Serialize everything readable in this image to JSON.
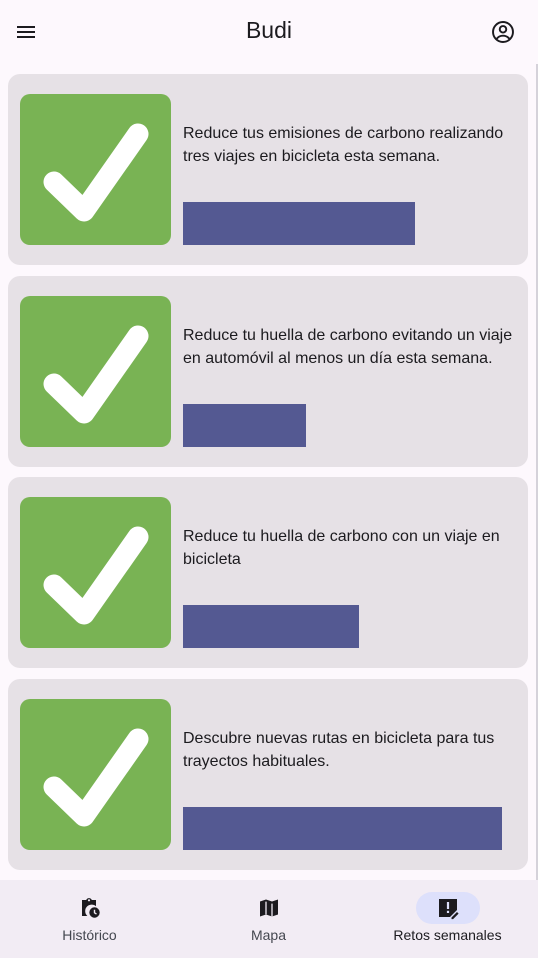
{
  "app": {
    "title": "Budi"
  },
  "challenges": [
    {
      "text": "Reduce tus emisiones de carbono realizando tres viajes en bicicleta esta semana.",
      "progress": 0.7,
      "completed": true
    },
    {
      "text": "Reduce tu huella de carbono evitando un viaje en automóvil al menos un día esta semana.",
      "progress": 0.37,
      "completed": true
    },
    {
      "text": "Reduce tu huella de carbono con un viaje en bicicleta",
      "progress": 0.53,
      "completed": true
    },
    {
      "text": "Descubre nuevas rutas en bicicleta para tus trayectos habituales.",
      "progress": 0.96,
      "completed": true
    }
  ],
  "bottom_nav": {
    "items": [
      {
        "label": "Histórico",
        "icon": "history-clipboard-icon",
        "active": false
      },
      {
        "label": "Mapa",
        "icon": "map-icon",
        "active": false
      },
      {
        "label": "Retos semanales",
        "icon": "weekly-challenge-icon",
        "active": true
      }
    ]
  },
  "colors": {
    "check_tile": "#79b354",
    "progress_bar": "#545992",
    "card_bg": "#e6e1e6",
    "active_pill": "#dde0fb"
  }
}
